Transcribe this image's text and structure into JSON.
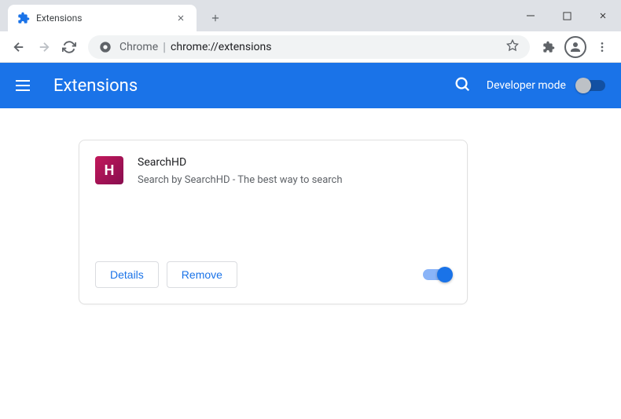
{
  "window": {
    "tab_title": "Extensions"
  },
  "toolbar": {
    "omnibox_prefix": "Chrome",
    "omnibox_url": "chrome://extensions"
  },
  "header": {
    "title": "Extensions",
    "dev_mode_label": "Developer mode"
  },
  "extension_card": {
    "name": "SearchHD",
    "description": "Search by SearchHD - The best way to search",
    "icon_glyph": "H",
    "details_label": "Details",
    "remove_label": "Remove",
    "enabled": true
  }
}
